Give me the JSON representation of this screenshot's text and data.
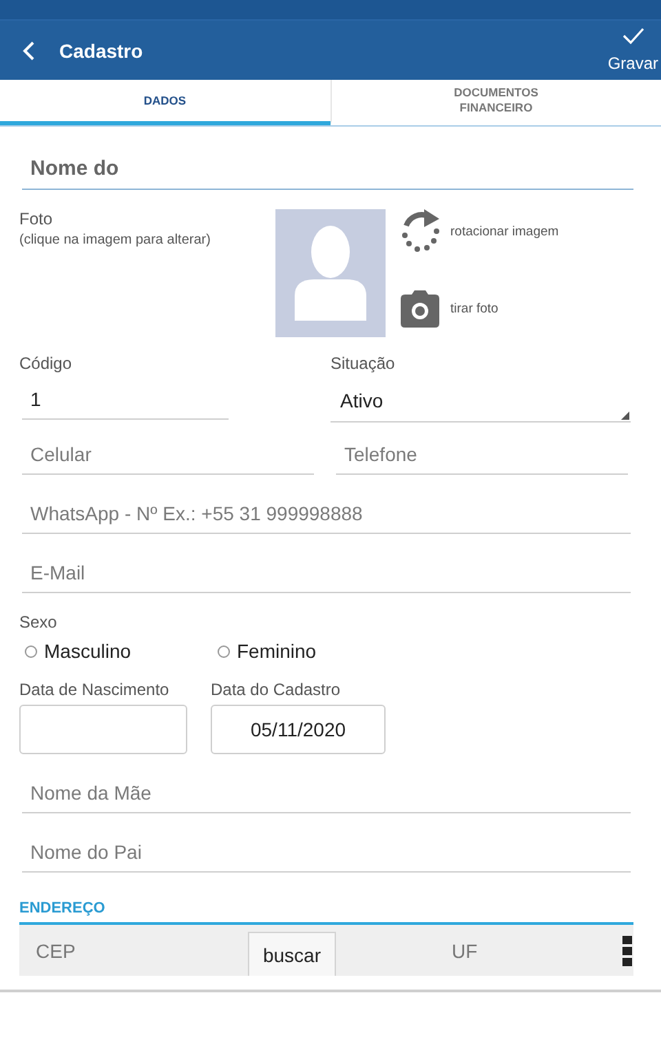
{
  "header": {
    "title": "Cadastro",
    "save_label": "Gravar"
  },
  "tabs": [
    {
      "label": "DADOS",
      "selected": true
    },
    {
      "label": "DOCUMENTOS\nFINANCEIRO",
      "selected": false
    }
  ],
  "name_field": {
    "placeholder": "Nome do"
  },
  "photo": {
    "label": "Foto",
    "hint": "(clique na imagem para alterar)",
    "rotate_label": "rotacionar imagem",
    "camera_label": "tirar foto"
  },
  "code": {
    "label": "Código",
    "value": "1"
  },
  "status": {
    "label": "Situação",
    "value": "Ativo"
  },
  "phones": [
    {
      "placeholder": "Celular"
    },
    {
      "placeholder": "Telefone"
    }
  ],
  "whatsapp": {
    "placeholder": "WhatsApp - Nº Ex.: +55 31 999998888"
  },
  "email": {
    "placeholder": "E-Mail"
  },
  "sex": {
    "label": "Sexo",
    "options": [
      {
        "label": "Masculino",
        "selected": false
      },
      {
        "label": "Feminino",
        "selected": false
      }
    ]
  },
  "dates": [
    {
      "label": "Data de Nascimento"
    },
    {
      "label": "Data do Cadastro",
      "value": "05/11/2020"
    }
  ],
  "parents": [
    {
      "placeholder": "Nome da Mãe"
    },
    {
      "placeholder": "Nome do Pai"
    }
  ],
  "address": {
    "title": "ENDEREÇO",
    "cep_placeholder": "CEP",
    "search_button": "buscar",
    "uf_placeholder": "UF"
  }
}
